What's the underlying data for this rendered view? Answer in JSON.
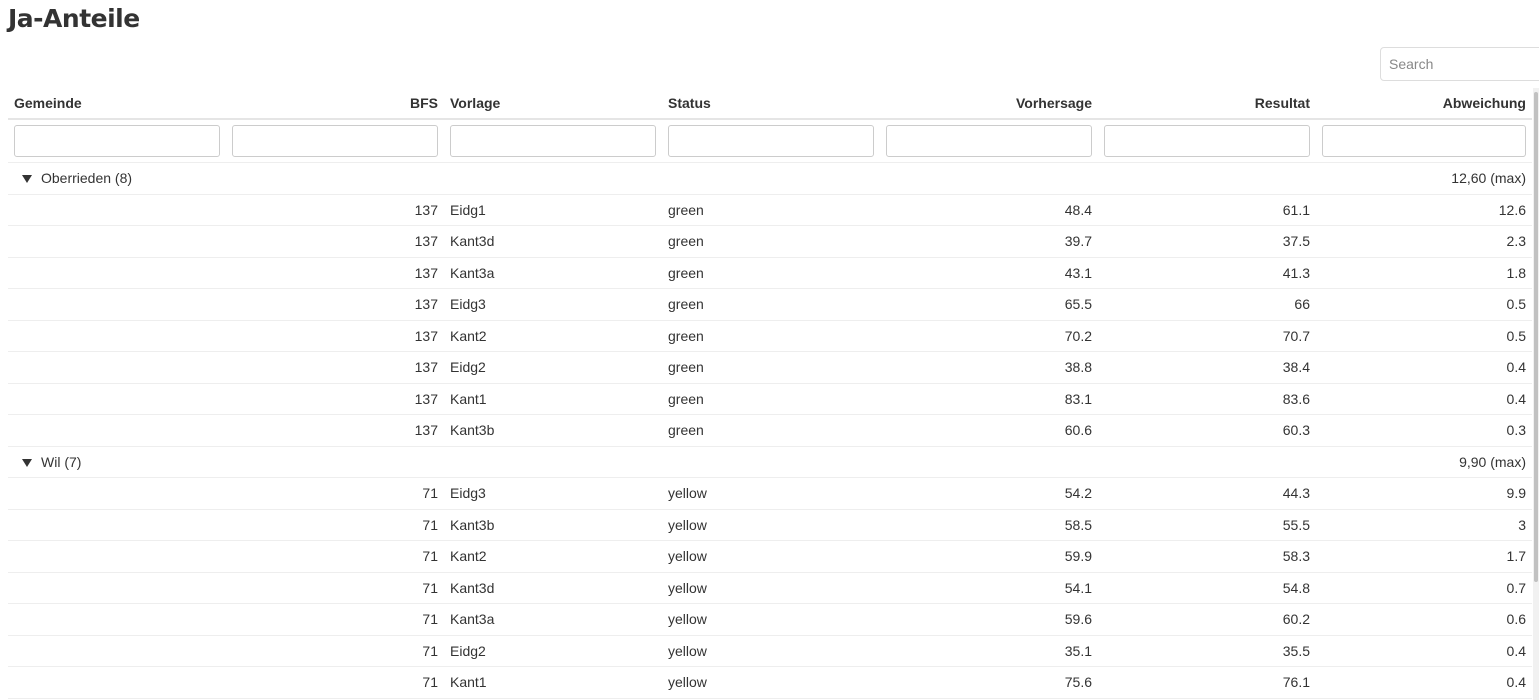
{
  "title": "Ja-Anteile",
  "search": {
    "placeholder": "Search"
  },
  "columns": [
    "Gemeinde",
    "BFS",
    "Vorlage",
    "Status",
    "Vorhersage",
    "Resultat",
    "Abweichung"
  ],
  "groups": [
    {
      "label": "Oberrieden (8)",
      "summary": "12,60 (max)",
      "rows": [
        {
          "bfs": "137",
          "vorlage": "Eidg1",
          "status": "green",
          "vorhersage": "48.4",
          "resultat": "61.1",
          "abweichung": "12.6"
        },
        {
          "bfs": "137",
          "vorlage": "Kant3d",
          "status": "green",
          "vorhersage": "39.7",
          "resultat": "37.5",
          "abweichung": "2.3"
        },
        {
          "bfs": "137",
          "vorlage": "Kant3a",
          "status": "green",
          "vorhersage": "43.1",
          "resultat": "41.3",
          "abweichung": "1.8"
        },
        {
          "bfs": "137",
          "vorlage": "Eidg3",
          "status": "green",
          "vorhersage": "65.5",
          "resultat": "66",
          "abweichung": "0.5"
        },
        {
          "bfs": "137",
          "vorlage": "Kant2",
          "status": "green",
          "vorhersage": "70.2",
          "resultat": "70.7",
          "abweichung": "0.5"
        },
        {
          "bfs": "137",
          "vorlage": "Eidg2",
          "status": "green",
          "vorhersage": "38.8",
          "resultat": "38.4",
          "abweichung": "0.4"
        },
        {
          "bfs": "137",
          "vorlage": "Kant1",
          "status": "green",
          "vorhersage": "83.1",
          "resultat": "83.6",
          "abweichung": "0.4"
        },
        {
          "bfs": "137",
          "vorlage": "Kant3b",
          "status": "green",
          "vorhersage": "60.6",
          "resultat": "60.3",
          "abweichung": "0.3"
        }
      ]
    },
    {
      "label": "Wil (7)",
      "summary": "9,90 (max)",
      "rows": [
        {
          "bfs": "71",
          "vorlage": "Eidg3",
          "status": "yellow",
          "vorhersage": "54.2",
          "resultat": "44.3",
          "abweichung": "9.9"
        },
        {
          "bfs": "71",
          "vorlage": "Kant3b",
          "status": "yellow",
          "vorhersage": "58.5",
          "resultat": "55.5",
          "abweichung": "3"
        },
        {
          "bfs": "71",
          "vorlage": "Kant2",
          "status": "yellow",
          "vorhersage": "59.9",
          "resultat": "58.3",
          "abweichung": "1.7"
        },
        {
          "bfs": "71",
          "vorlage": "Kant3d",
          "status": "yellow",
          "vorhersage": "54.1",
          "resultat": "54.8",
          "abweichung": "0.7"
        },
        {
          "bfs": "71",
          "vorlage": "Kant3a",
          "status": "yellow",
          "vorhersage": "59.6",
          "resultat": "60.2",
          "abweichung": "0.6"
        },
        {
          "bfs": "71",
          "vorlage": "Eidg2",
          "status": "yellow",
          "vorhersage": "35.1",
          "resultat": "35.5",
          "abweichung": "0.4"
        },
        {
          "bfs": "71",
          "vorlage": "Kant1",
          "status": "yellow",
          "vorhersage": "75.6",
          "resultat": "76.1",
          "abweichung": "0.4"
        }
      ]
    }
  ]
}
